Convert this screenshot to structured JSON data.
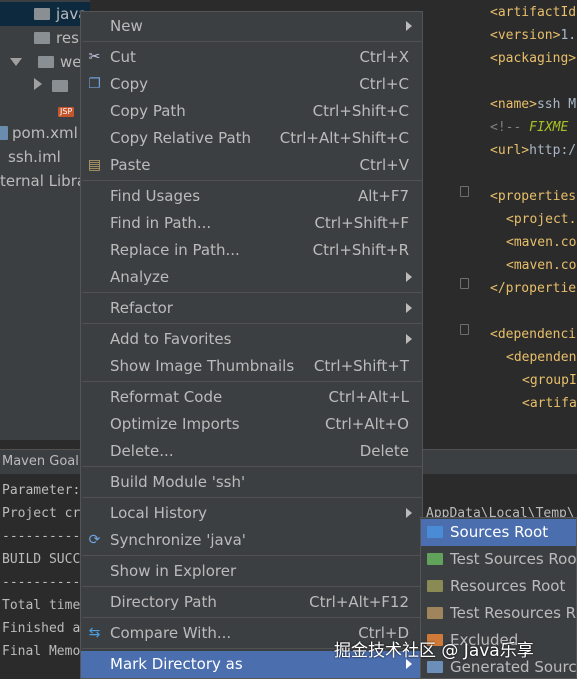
{
  "tree": {
    "items": [
      {
        "label": "java",
        "kind": "folder",
        "selected": true
      },
      {
        "label": "res",
        "kind": "folder"
      },
      {
        "label": "we",
        "kind": "folder-open"
      },
      {
        "label": "",
        "kind": "folder"
      },
      {
        "label": "JSP",
        "kind": "jsp"
      },
      {
        "label": "pom.xml",
        "kind": "file"
      },
      {
        "label": "ssh.iml",
        "kind": "file"
      },
      {
        "label": "ternal Libra",
        "kind": "lib"
      }
    ]
  },
  "editor": {
    "lines": [
      {
        "tag": "<artifactId",
        "txt": ""
      },
      {
        "tag": "<version>",
        "txt": "1."
      },
      {
        "tag": "<packaging>",
        "txt": ""
      },
      {
        "tag": "",
        "txt": ""
      },
      {
        "tag": "<name>",
        "txt": "ssh M"
      },
      {
        "comment": "<!-- ",
        "todo": "FIXME"
      },
      {
        "tag": "<url>",
        "txt": "http:/"
      },
      {
        "tag": "",
        "txt": ""
      },
      {
        "tag": "<properties",
        "txt": ""
      },
      {
        "tag": "<project.",
        "txt": ""
      },
      {
        "tag": "<maven.co",
        "txt": ""
      },
      {
        "tag": "<maven.co",
        "txt": ""
      },
      {
        "tag": "</propertie",
        "txt": ""
      },
      {
        "tag": "",
        "txt": ""
      },
      {
        "tag": "<dependenci",
        "txt": ""
      },
      {
        "tag": "<dependen",
        "txt": ""
      },
      {
        "tag": "<groupI",
        "txt": ""
      },
      {
        "tag": "<artifa",
        "txt": ""
      }
    ]
  },
  "maven": {
    "title": "Maven Goal",
    "path": "AppData\\Local\\Temp\\",
    "console": [
      "Parameter:",
      "Project cr",
      "----------",
      "BUILD SUCC",
      "----------",
      "Total time",
      "Finished a",
      "Final Memo"
    ]
  },
  "menu": {
    "items": [
      {
        "label": "New",
        "shortcut": "",
        "submenu": true,
        "icon": ""
      },
      {
        "sep": true
      },
      {
        "label": "Cut",
        "shortcut": "Ctrl+X",
        "icon": "scissors-icon"
      },
      {
        "label": "Copy",
        "shortcut": "Ctrl+C",
        "icon": "copy-icon"
      },
      {
        "label": "Copy Path",
        "shortcut": "Ctrl+Shift+C"
      },
      {
        "label": "Copy Relative Path",
        "shortcut": "Ctrl+Alt+Shift+C"
      },
      {
        "label": "Paste",
        "shortcut": "Ctrl+V",
        "icon": "paste-icon"
      },
      {
        "sep": true
      },
      {
        "label": "Find Usages",
        "shortcut": "Alt+F7"
      },
      {
        "label": "Find in Path...",
        "shortcut": "Ctrl+Shift+F"
      },
      {
        "label": "Replace in Path...",
        "shortcut": "Ctrl+Shift+R"
      },
      {
        "label": "Analyze",
        "submenu": true
      },
      {
        "sep": true
      },
      {
        "label": "Refactor",
        "submenu": true
      },
      {
        "sep": true
      },
      {
        "label": "Add to Favorites",
        "submenu": true
      },
      {
        "label": "Show Image Thumbnails",
        "shortcut": "Ctrl+Shift+T"
      },
      {
        "sep": true
      },
      {
        "label": "Reformat Code",
        "shortcut": "Ctrl+Alt+L"
      },
      {
        "label": "Optimize Imports",
        "shortcut": "Ctrl+Alt+O"
      },
      {
        "label": "Delete...",
        "shortcut": "Delete"
      },
      {
        "sep": true
      },
      {
        "label": "Build Module 'ssh'"
      },
      {
        "sep": true
      },
      {
        "label": "Local History",
        "submenu": true
      },
      {
        "label": "Synchronize 'java'",
        "icon": "sync-icon"
      },
      {
        "sep": true
      },
      {
        "label": "Show in Explorer"
      },
      {
        "sep": true
      },
      {
        "label": "Directory Path",
        "shortcut": "Ctrl+Alt+F12"
      },
      {
        "sep": true
      },
      {
        "label": "Compare With...",
        "shortcut": "Ctrl+D",
        "icon": "compare-icon"
      },
      {
        "sep": true
      },
      {
        "label": "Mark Directory as",
        "submenu": true,
        "highlighted": true
      }
    ]
  },
  "submenu": {
    "items": [
      {
        "label": "Sources Root",
        "color": "#4a8bd6",
        "highlighted": true
      },
      {
        "label": "Test Sources Root",
        "color": "#62a35c"
      },
      {
        "label": "Resources Root",
        "color": "#8a8a55"
      },
      {
        "label": "Test Resources Root",
        "color": "#a0845c"
      },
      {
        "label": "Excluded",
        "color": "#d07a3a"
      },
      {
        "label": "Generated Sources Root",
        "color": "#6c8fb8"
      }
    ]
  },
  "watermark": "掘金技术社区 @ Java乐享"
}
